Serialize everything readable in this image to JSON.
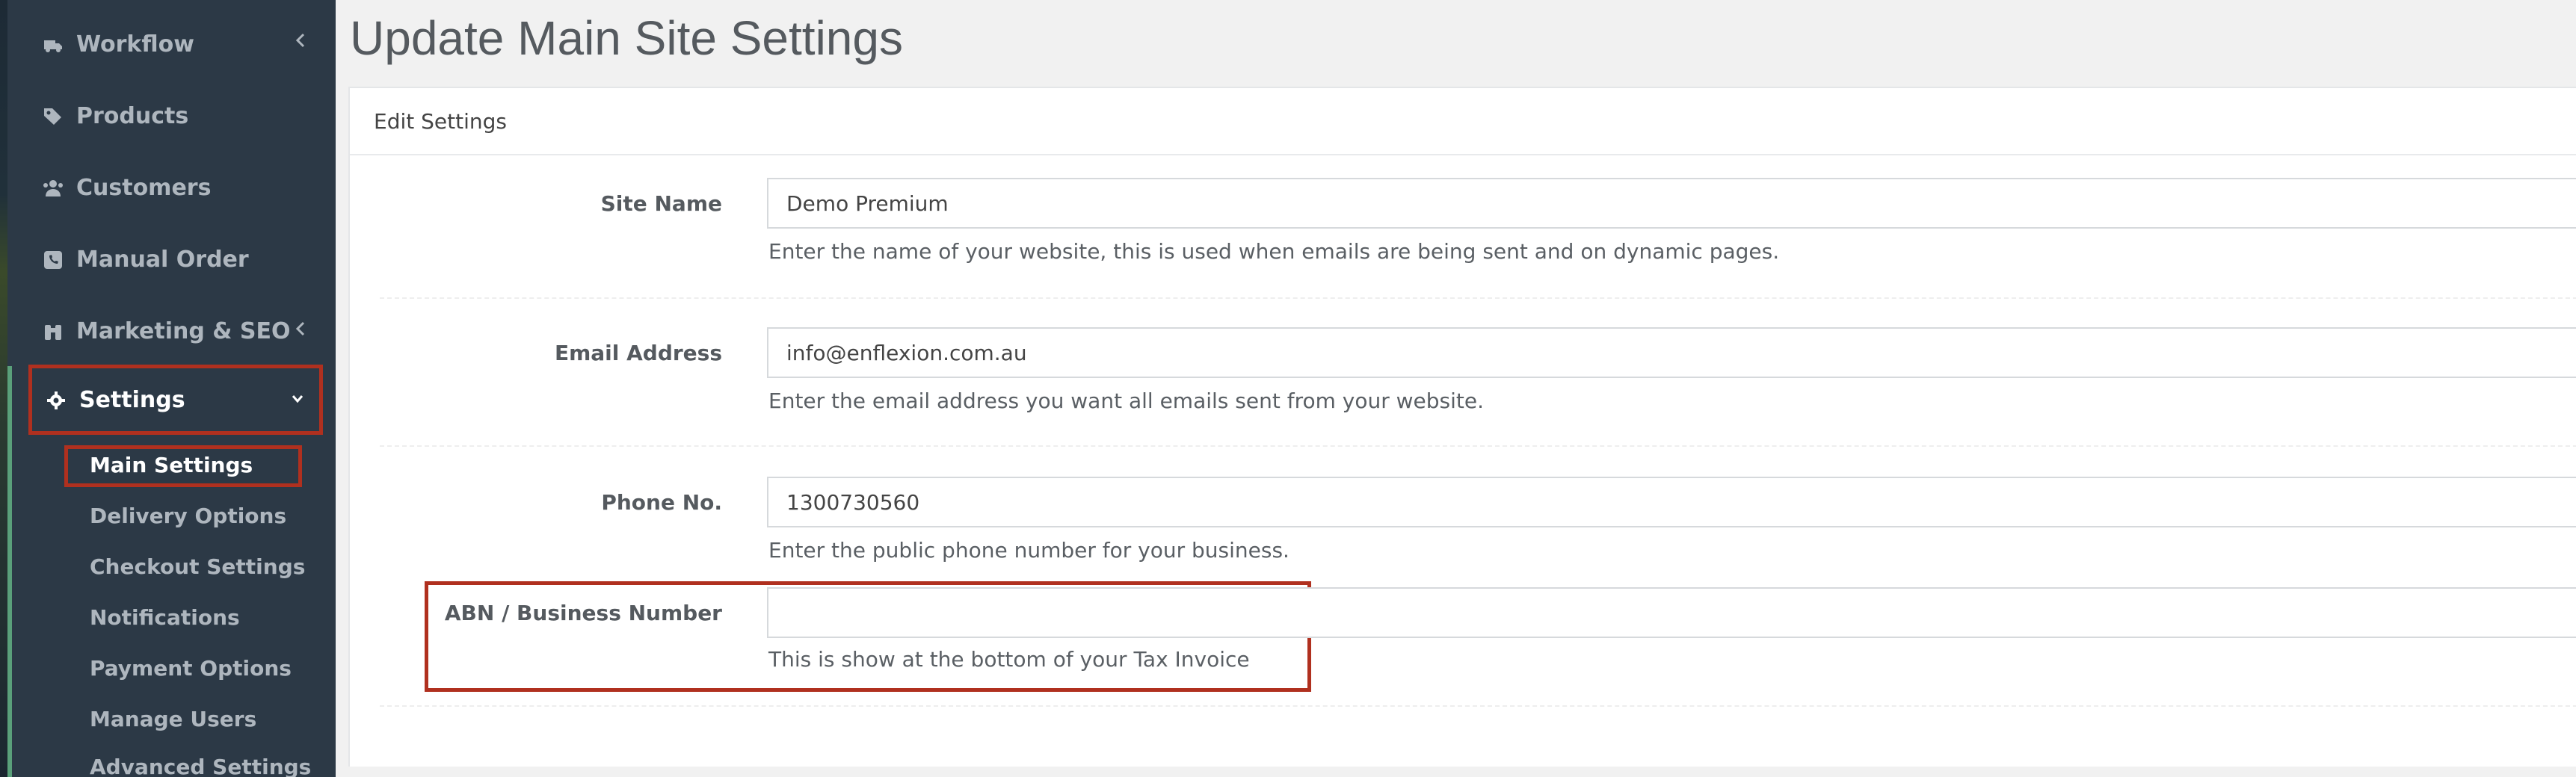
{
  "sidebar": {
    "items": [
      {
        "label": "Workflow",
        "icon": "truck-icon",
        "has_chevron": true
      },
      {
        "label": "Products",
        "icon": "tags-icon",
        "has_chevron": false
      },
      {
        "label": "Customers",
        "icon": "users-icon",
        "has_chevron": false
      },
      {
        "label": "Manual Order",
        "icon": "phone-square-icon",
        "has_chevron": false
      },
      {
        "label": "Marketing & SEO",
        "icon": "binoculars-icon",
        "has_chevron": true
      }
    ],
    "active_section": {
      "label": "Settings",
      "icon": "gear-icon",
      "chevron": "chevron-down-icon"
    },
    "sub_items": [
      {
        "label": "Main Settings",
        "active": true
      },
      {
        "label": "Delivery Options"
      },
      {
        "label": "Checkout Settings"
      },
      {
        "label": "Notifications"
      },
      {
        "label": "Payment Options"
      },
      {
        "label": "Manage Users"
      },
      {
        "label": "Advanced Settings"
      }
    ],
    "highlight_color": "#b0301f",
    "background": "#2c3946"
  },
  "page": {
    "title": "Update Main Site Settings"
  },
  "panel": {
    "heading": "Edit Settings",
    "fields": [
      {
        "label": "Site Name",
        "value": "Demo Premium",
        "help": "Enter the name of your website, this is used when emails are being sent and on dynamic pages."
      },
      {
        "label": "Email Address",
        "value": "info@enflexion.com.au",
        "help": "Enter the email address you want all emails sent from your website."
      },
      {
        "label": "Phone No.",
        "value": "1300730560",
        "help": "Enter the public phone number for your business."
      },
      {
        "label": "ABN / Business Number",
        "value": "",
        "help": "This is show at the bottom of your Tax Invoice"
      }
    ]
  }
}
